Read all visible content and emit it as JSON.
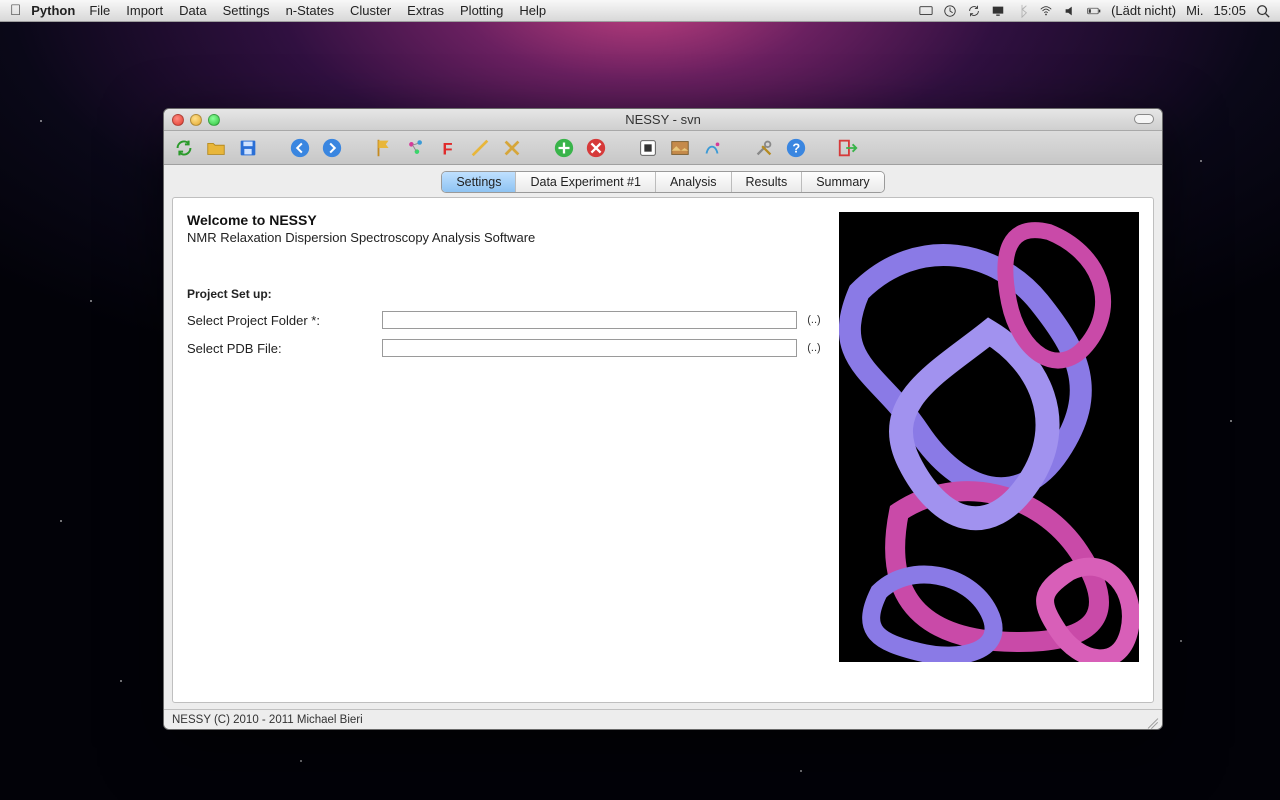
{
  "menubar": {
    "app": "Python",
    "items": [
      "File",
      "Import",
      "Data",
      "Settings",
      "n-States",
      "Cluster",
      "Extras",
      "Plotting",
      "Help"
    ],
    "status_label": "(Lädt nicht)",
    "day": "Mi.",
    "time": "15:05"
  },
  "window": {
    "title": "NESSY - svn"
  },
  "tabs": {
    "items": [
      "Settings",
      "Data Experiment #1",
      "Analysis",
      "Results",
      "Summary"
    ],
    "active_index": 0
  },
  "settings": {
    "welcome": "Welcome to NESSY",
    "subtitle": "NMR Relaxation Dispersion Spectroscopy Analysis Software",
    "section": "Project Set up:",
    "folder_label": "Select Project Folder *:",
    "folder_value": "",
    "pdb_label": "Select PDB File:",
    "pdb_value": "",
    "browse_label": "(..)"
  },
  "status": {
    "text": "NESSY (C) 2010 - 2011 Michael Bieri"
  }
}
